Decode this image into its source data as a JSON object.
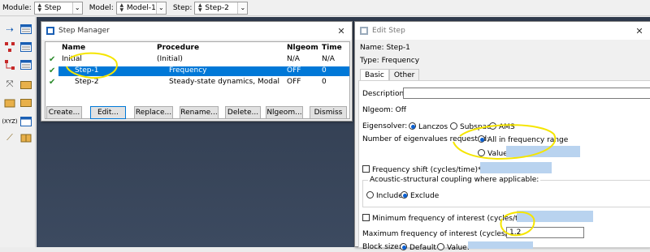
{
  "context_bar": {
    "module_label": "Module:",
    "module_value": "Step",
    "model_label": "Model:",
    "model_value": "Model-1",
    "step_label": "Step:",
    "step_value": "Step-2"
  },
  "step_manager": {
    "title": "Step Manager",
    "columns": {
      "name": "Name",
      "procedure": "Procedure",
      "nlgeom": "Nlgeom",
      "time": "Time"
    },
    "rows": [
      {
        "name": "Initial",
        "procedure": "(Initial)",
        "nlgeom": "N/A",
        "time": "N/A",
        "check": "✔",
        "selected": false
      },
      {
        "name": "Step-1",
        "procedure": "Frequency",
        "nlgeom": "OFF",
        "time": "0",
        "check": "✔",
        "selected": true
      },
      {
        "name": "Step-2",
        "procedure": "Steady-state dynamics, Modal",
        "nlgeom": "OFF",
        "time": "0",
        "check": "✔",
        "selected": false
      }
    ],
    "buttons": {
      "create": "Create...",
      "edit": "Edit...",
      "replace": "Replace...",
      "rename": "Rename...",
      "delete": "Delete...",
      "nlgeom": "Nlgeom...",
      "dismiss": "Dismiss"
    }
  },
  "edit_step": {
    "title": "Edit Step",
    "name_line": "Name: Step-1",
    "type_line": "Type: Frequency",
    "tabs": {
      "basic": "Basic",
      "other": "Other"
    },
    "description_label": "Description:",
    "description_value": "",
    "nlgeom_line": "Nlgeom: Off",
    "eigensolver_label": "Eigensolver:",
    "eigensolver_options": {
      "lanczos": "Lanczos",
      "subspace": "Subspace",
      "ams": "AMS"
    },
    "num_eigen_label": "Number of eigenvalues requested:",
    "all_in_range": "All in frequency range",
    "value_label": "Value:",
    "freq_shift_label": "Frequency shift (cycles/time)**2:",
    "acoustic_legend": "Acoustic-structural coupling where applicable:",
    "include_label": "Include",
    "exclude_label": "Exclude",
    "min_freq_label": "Minimum frequency of interest (cycles/time):",
    "max_freq_label": "Maximum frequency of interest (cycles/time):",
    "max_freq_value": "1.2",
    "block_size_label": "Block size:",
    "default_label": "Default",
    "block_value_label": "Value:"
  },
  "colors": {
    "selection": "#0078d7",
    "annotation": "#f5e500",
    "disabled_field": "#b9d3ef"
  }
}
